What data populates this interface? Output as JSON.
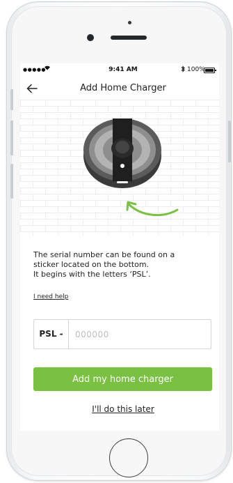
{
  "status_bar": {
    "signal": "●●●●●",
    "time": "9:41 AM",
    "battery": "100%"
  },
  "nav": {
    "title": "Add Home Charger",
    "back_icon": "arrow-left-icon"
  },
  "illustration": {
    "description_icon": "charger-bottom-icon",
    "arrow_icon": "curved-arrow-icon",
    "accent_color": "#7ac143"
  },
  "instructions": {
    "line1": "The serial number can be found on a",
    "line2": "sticker located on the bottom.",
    "line3": "It begins with the letters ‘PSL’."
  },
  "help_link": "I need help",
  "serial": {
    "prefix": "PSL -",
    "placeholder": "000000",
    "value": ""
  },
  "primary_button": "Add my home charger",
  "secondary_link": "I'll do this later",
  "colors": {
    "brand_green": "#7ac143",
    "text": "#222222",
    "border": "#d6d6d6"
  }
}
